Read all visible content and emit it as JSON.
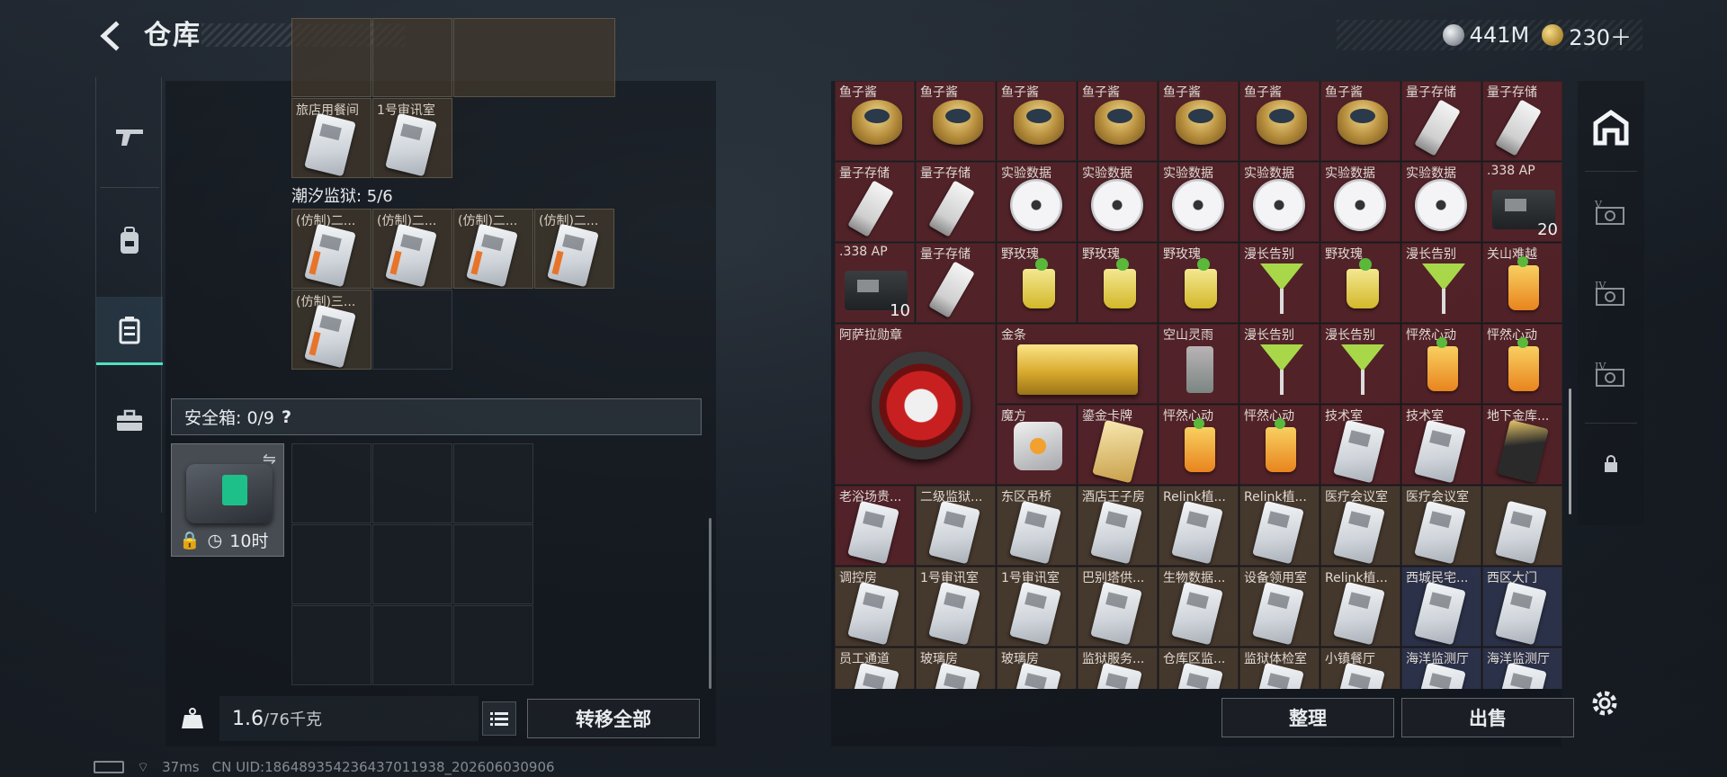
{
  "header": {
    "title": "仓库"
  },
  "currency": [
    {
      "icon": "silver-coin-icon",
      "value": "441M"
    },
    {
      "icon": "gold-coin-icon",
      "value": "230＋"
    }
  ],
  "left_nav": [
    "weapon-icon",
    "backpack-icon",
    "container-icon",
    "toolbox-icon"
  ],
  "storage": {
    "row_top_labels": [
      "旅店用餐间",
      "1号审讯室"
    ],
    "section_title": "潮汐监狱: 5/6",
    "prison_cards": [
      "(仿制)二...",
      "(仿制)二...",
      "(仿制)二...",
      "(仿制)二...",
      "(仿制)三..."
    ],
    "safebox_label": "安全箱: 0/9",
    "safebox_help": "?",
    "safebox_timer": "10时",
    "weight_current": "1.6",
    "weight_max": "/76千克",
    "transfer_all": "转移全部"
  },
  "inventory": {
    "rows": [
      [
        "鱼子酱",
        "鱼子酱",
        "鱼子酱",
        "鱼子酱",
        "鱼子酱",
        "鱼子酱",
        "鱼子酱",
        "量子存储",
        "量子存储"
      ],
      [
        "量子存储",
        "量子存储",
        "实验数据",
        "实验数据",
        "实验数据",
        "实验数据",
        "实验数据",
        "实验数据",
        ".338 AP"
      ],
      [
        ".338 AP",
        "量子存储",
        "野玫瑰",
        "野玫瑰",
        "野玫瑰",
        "漫长告别",
        "野玫瑰",
        "漫长告别",
        "关山难越"
      ],
      [
        "阿萨拉勋章",
        "",
        "金条",
        "",
        "空山灵雨",
        "漫长告别",
        "漫长告别",
        "怦然心动",
        "怦然心动"
      ],
      [
        "",
        "",
        "魔方",
        "鎏金卡牌",
        "怦然心动",
        "怦然心动",
        "技术室",
        "技术室",
        "地下金库..."
      ],
      [
        "老浴场贵...",
        "二级监狱...",
        "东区吊桥",
        "酒店王子房",
        "Relink植...",
        "Relink植...",
        "医疗会议室",
        "医疗会议室",
        ""
      ],
      [
        "调控房",
        "1号审讯室",
        "1号审讯室",
        "巴别塔供...",
        "生物数据...",
        "设备领用室",
        "Relink植...",
        "西城民宅...",
        "西区大门"
      ],
      [
        "员工通道",
        "玻璃房",
        "玻璃房",
        "监狱服务...",
        "仓库区监...",
        "监狱体检室",
        "小镇餐厅",
        "海洋监测厅",
        "海洋监测厅"
      ]
    ],
    "counts": {
      "ammo_1": "20",
      "ammo_2": "10"
    },
    "sort_label": "整理",
    "sell_label": "出售"
  },
  "status": {
    "ping": "37ms",
    "uid": "CN UID:18648935423643701193​8_202606030906"
  }
}
